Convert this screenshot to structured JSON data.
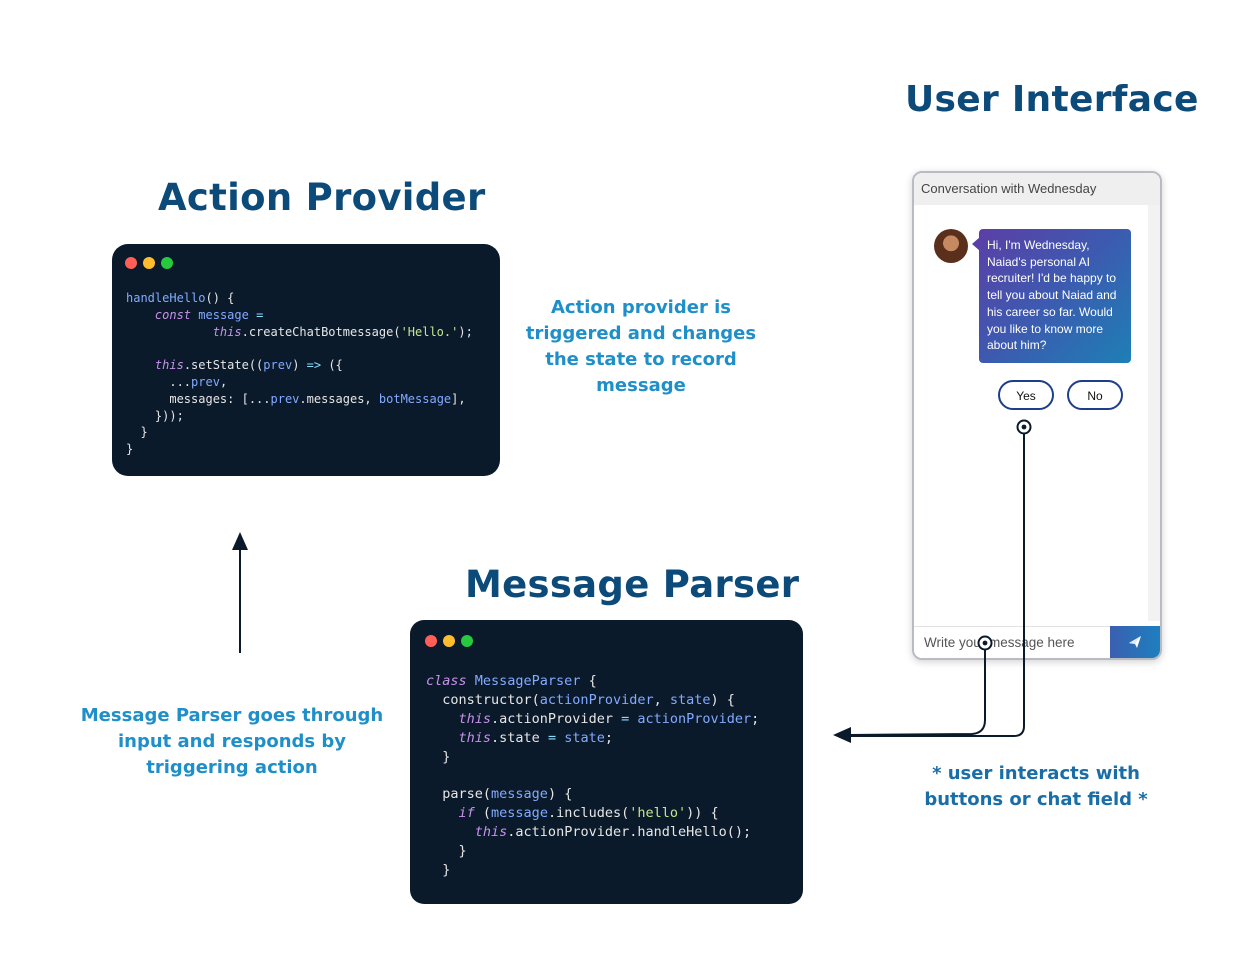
{
  "headings": {
    "user_interface": "User Interface",
    "action_provider": "Action Provider",
    "message_parser": "Message Parser"
  },
  "captions": {
    "action_provider": "Action provider is triggered and changes the state to record message",
    "message_parser": "Message Parser goes through input and responds by triggering action",
    "user_interaction": "* user interacts with buttons or chat field *"
  },
  "code": {
    "action_provider": [
      [
        [
          "fn",
          "handleHello"
        ],
        [
          "pl",
          "() {"
        ]
      ],
      [
        [
          "pl",
          "    "
        ],
        [
          "kw",
          "const"
        ],
        [
          "pl",
          " "
        ],
        [
          "fn",
          "message"
        ],
        [
          "pl",
          " "
        ],
        [
          "op",
          "="
        ]
      ],
      [
        [
          "pl",
          "            "
        ],
        [
          "kw",
          "this"
        ],
        [
          "pl",
          ".createChatBotmessage("
        ],
        [
          "str",
          "'Hello.'"
        ],
        [
          "pl",
          ");"
        ]
      ],
      [],
      [
        [
          "pl",
          "    "
        ],
        [
          "kw",
          "this"
        ],
        [
          "pl",
          ".setState(("
        ],
        [
          "fn",
          "prev"
        ],
        [
          "pl",
          ") "
        ],
        [
          "op",
          "=>"
        ],
        [
          "pl",
          " ({"
        ]
      ],
      [
        [
          "pl",
          "      ..."
        ],
        [
          "fn",
          "prev"
        ],
        [
          "pl",
          ","
        ]
      ],
      [
        [
          "pl",
          "      messages: [..."
        ],
        [
          "fn",
          "prev"
        ],
        [
          "pl",
          ".messages, "
        ],
        [
          "fn",
          "botMessage"
        ],
        [
          "pl",
          "],"
        ]
      ],
      [
        [
          "pl",
          "    }));"
        ]
      ],
      [
        [
          "pl",
          "  }"
        ]
      ],
      [
        [
          "pl",
          "}"
        ]
      ]
    ],
    "message_parser": [
      [
        [
          "kw",
          "class"
        ],
        [
          "pl",
          " "
        ],
        [
          "fn",
          "MessageParser"
        ],
        [
          "pl",
          " {"
        ]
      ],
      [
        [
          "pl",
          "  constructor("
        ],
        [
          "fn",
          "actionProvider"
        ],
        [
          "pl",
          ", "
        ],
        [
          "fn",
          "state"
        ],
        [
          "pl",
          ") {"
        ]
      ],
      [
        [
          "pl",
          "    "
        ],
        [
          "kw",
          "this"
        ],
        [
          "pl",
          ".actionProvider "
        ],
        [
          "op",
          "="
        ],
        [
          "pl",
          " "
        ],
        [
          "fn",
          "actionProvider"
        ],
        [
          "pl",
          ";"
        ]
      ],
      [
        [
          "pl",
          "    "
        ],
        [
          "kw",
          "this"
        ],
        [
          "pl",
          ".state "
        ],
        [
          "op",
          "="
        ],
        [
          "pl",
          " "
        ],
        [
          "fn",
          "state"
        ],
        [
          "pl",
          ";"
        ]
      ],
      [
        [
          "pl",
          "  }"
        ]
      ],
      [],
      [
        [
          "pl",
          "  parse("
        ],
        [
          "fn",
          "message"
        ],
        [
          "pl",
          ") {"
        ]
      ],
      [
        [
          "pl",
          "    "
        ],
        [
          "kw",
          "if"
        ],
        [
          "pl",
          " ("
        ],
        [
          "fn",
          "message"
        ],
        [
          "pl",
          ".includes("
        ],
        [
          "str",
          "'hello'"
        ],
        [
          "pl",
          ")) {"
        ]
      ],
      [
        [
          "pl",
          "      "
        ],
        [
          "kw",
          "this"
        ],
        [
          "pl",
          ".actionProvider.handleHello();"
        ]
      ],
      [
        [
          "pl",
          "    }"
        ]
      ],
      [
        [
          "pl",
          "  }"
        ]
      ]
    ]
  },
  "chat": {
    "header": "Conversation with Wednesday",
    "bot_message": "Hi, I'm Wednesday, Naiad's personal AI recruiter! I'd be happy to tell you about Naiad and his career so far. Would you like to know more about him?",
    "options": [
      "Yes",
      "No"
    ],
    "input_placeholder": "Write your message here",
    "send_icon": "paper-plane-icon"
  },
  "colors": {
    "heading": "#0c4a7a",
    "caption": "#1f8fc9",
    "code_bg": "#0b1a2b",
    "arrow": "#0b1a2b",
    "button_border": "#1d3f8a"
  }
}
